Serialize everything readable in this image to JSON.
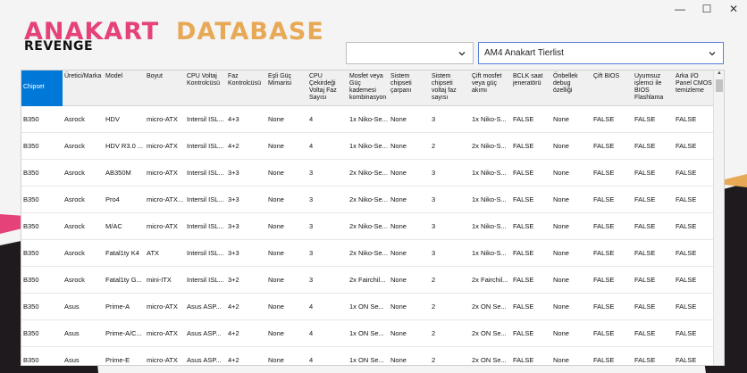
{
  "window": {
    "minimize": "—",
    "maximize": "☐",
    "close": "✕"
  },
  "logo": {
    "anakart": "ANAKART",
    "revenge": "REVENGE",
    "database": "DATABASE"
  },
  "filters": {
    "filter1_value": "",
    "filter2_value": "AM4 Anakart Tierlist"
  },
  "colors": {
    "accent": "#0078d7",
    "pink": "#e5427a",
    "orange": "#e8a956",
    "dark": "#1e1a1d"
  },
  "table": {
    "columns": [
      "Chipset",
      "Üretici/Marka",
      "Model",
      "Boyut",
      "CPU Voltaj Kontrolcüsü",
      "Faz Kontrolcüsü",
      "Eşli Güç Mimarisi",
      "CPU Çekirdeği Voltaj Faz Sayısı",
      "Mosfet veya Güç kademesi kombinasyon",
      "Sistem chipseti çarpanı",
      "Sistem chipseti voltaj faz sayısı",
      "Çift mosfet veya güç akımı",
      "BCLK saat jeneratörü",
      "Önbellek debug özelliği",
      "Çift BIOS",
      "Uyumsuz işlemci ile BIOS Flashlama",
      "Arka I/O Panel CMOS temizleme"
    ],
    "rows": [
      [
        "B350",
        "Asrock",
        "HDV",
        "micro-ATX",
        "Intersil ISL...",
        "4+3",
        "None",
        "4",
        "1x Niko-Se...",
        "None",
        "3",
        "1x Niko-S...",
        "FALSE",
        "None",
        "FALSE",
        "FALSE",
        "FALSE"
      ],
      [
        "B350",
        "Asrock",
        "HDV R3.0 ...",
        "micro-ATX",
        "Intersil ISL...",
        "4+2",
        "None",
        "4",
        "1x Niko-Se...",
        "None",
        "2",
        "2x Niko-S...",
        "FALSE",
        "None",
        "FALSE",
        "FALSE",
        "FALSE"
      ],
      [
        "B350",
        "Asrock",
        "AB350M",
        "micro-ATX",
        "Intersil ISL...",
        "3+3",
        "None",
        "3",
        "2x Niko-Se...",
        "None",
        "3",
        "1x Niko-S...",
        "FALSE",
        "None",
        "FALSE",
        "FALSE",
        "FALSE"
      ],
      [
        "B350",
        "Asrock",
        "Pro4",
        "micro-ATX...",
        "Intersil ISL...",
        "3+3",
        "None",
        "3",
        "2x Niko-Se...",
        "None",
        "3",
        "1x Niko-S...",
        "FALSE",
        "None",
        "FALSE",
        "FALSE",
        "FALSE"
      ],
      [
        "B350",
        "Asrock",
        "M/AC",
        "micro-ATX",
        "Intersil ISL...",
        "3+3",
        "None",
        "3",
        "2x Niko-Se...",
        "None",
        "3",
        "1x Niko-S...",
        "FALSE",
        "None",
        "FALSE",
        "FALSE",
        "FALSE"
      ],
      [
        "B350",
        "Asrock",
        "Fatal1ty K4",
        "ATX",
        "Intersil ISL...",
        "3+3",
        "None",
        "3",
        "2x Niko-Se...",
        "None",
        "3",
        "1x Niko-S...",
        "FALSE",
        "None",
        "FALSE",
        "FALSE",
        "FALSE"
      ],
      [
        "B350",
        "Asrock",
        "Fatal1ty G...",
        "mini-ITX",
        "Intersil ISL...",
        "3+2",
        "None",
        "3",
        "2x Fairchil...",
        "None",
        "2",
        "2x Fairchil...",
        "FALSE",
        "None",
        "FALSE",
        "FALSE",
        "FALSE"
      ],
      [
        "B350",
        "Asus",
        "Prime-A",
        "micro-ATX",
        "Asus ASP...",
        "4+2",
        "None",
        "4",
        "1x ON Se...",
        "None",
        "2",
        "2x ON Se...",
        "FALSE",
        "None",
        "FALSE",
        "FALSE",
        "FALSE"
      ],
      [
        "B350",
        "Asus",
        "Prime-A/C...",
        "micro-ATX",
        "Asus ASP...",
        "4+2",
        "None",
        "4",
        "1x ON Se...",
        "None",
        "2",
        "2x ON Se...",
        "FALSE",
        "None",
        "FALSE",
        "FALSE",
        "FALSE"
      ],
      [
        "B350",
        "Asus",
        "Prime-E",
        "micro-ATX",
        "Asus ASP...",
        "4+2",
        "None",
        "4",
        "1x ON Se...",
        "None",
        "2",
        "2x ON Se...",
        "FALSE",
        "None",
        "FALSE",
        "FALSE",
        "FALSE"
      ]
    ]
  }
}
